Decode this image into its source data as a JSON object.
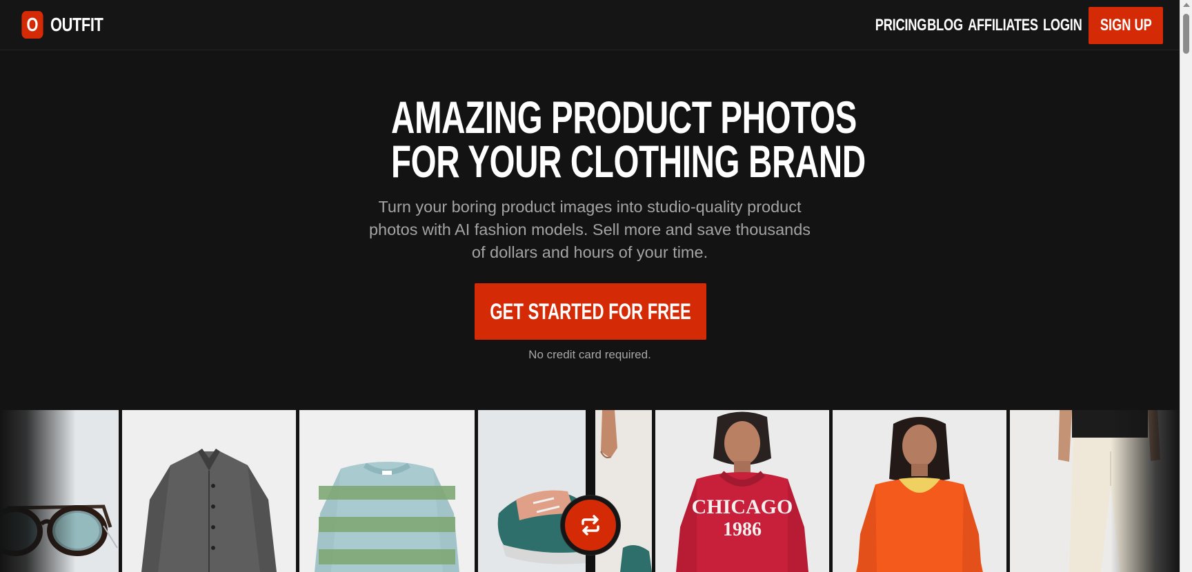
{
  "brand": {
    "mark": "O",
    "name": "OUTFIT",
    "accent_color": "#d52a06"
  },
  "nav": {
    "links": [
      "PRICING",
      "BLOG",
      "AFFILIATES",
      "LOGIN"
    ],
    "signup_label": "SIGN UP"
  },
  "hero": {
    "title_line1": "AMAZING PRODUCT PHOTOS",
    "title_line2": "FOR YOUR CLOTHING BRAND",
    "subtitle": "Turn your boring product images into studio-quality product photos with AI fashion models. Sell more and save thousands of dollars and hours of your time.",
    "cta_label": "GET STARTED FOR FREE",
    "note": "No credit card required."
  },
  "gallery": {
    "hoodie_print_line1": "CHICAGO",
    "hoodie_print_line2": "1986",
    "swap_icon": "swap-arrows-icon",
    "items": [
      "sunglasses-photo",
      "grey-coat-photo",
      "green-sweater-photo",
      "sneaker-photo",
      "model-arm-photo",
      "model-red-hoodie-photo",
      "model-orange-sweater-photo",
      "model-white-pants-photo"
    ]
  }
}
